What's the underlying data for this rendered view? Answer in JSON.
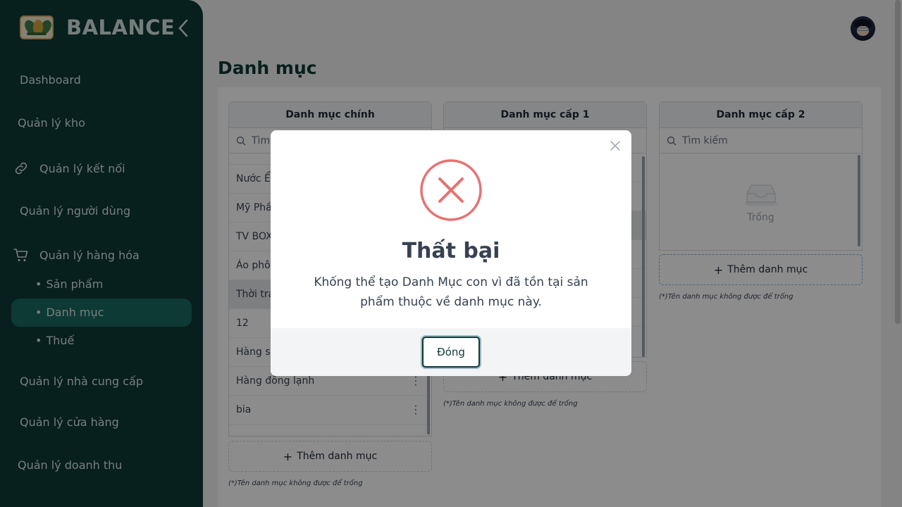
{
  "brand": {
    "name": "BALANCE"
  },
  "sidebar": {
    "items": [
      {
        "label": "Dashboard"
      },
      {
        "label": "Quản lý kho"
      },
      {
        "label": "Quản lý kết nối"
      },
      {
        "label": "Quản lý người dùng"
      },
      {
        "label": "Quản lý hàng hóa"
      },
      {
        "label": "Quản lý nhà cung cấp"
      },
      {
        "label": "Quản lý cửa hàng"
      },
      {
        "label": "Quản lý doanh thu"
      }
    ],
    "sub_items": [
      {
        "label": "Sản phẩm"
      },
      {
        "label": "Danh mục"
      },
      {
        "label": "Thuế"
      }
    ],
    "bullet": "•"
  },
  "page": {
    "title": "Danh mục"
  },
  "columns": [
    {
      "header": "Danh mục chính",
      "search_placeholder": "Tìm",
      "rows": [
        "Nước Ể",
        "Mỹ Phẩ",
        "TV BOX",
        "Áo phô",
        "Thời tra",
        "12",
        "Hàng s",
        "Hàng đông lạnh",
        "bia"
      ],
      "add_label": "Thêm danh mục",
      "hint": "(*)Tên danh mục không được để trống"
    },
    {
      "header": "Danh mục cấp 1",
      "add_label": "Thêm danh mục",
      "hint": "(*)Tên danh mục không được để trống"
    },
    {
      "header": "Danh mục cấp 2",
      "search_placeholder": "Tìm kiếm",
      "empty_text": "Trống",
      "add_label": "Thêm danh mục",
      "hint": "(*)Tên danh mục không được để trống"
    }
  ],
  "modal": {
    "title": "Thất bại",
    "message": "Khống thể tạo Danh Mục con vì đã tồn tại sản phẩm thuộc về danh mục này.",
    "button": "Đóng",
    "error_color": "#e57373"
  },
  "icons": {
    "plus": "+",
    "kebab": "⋮"
  }
}
